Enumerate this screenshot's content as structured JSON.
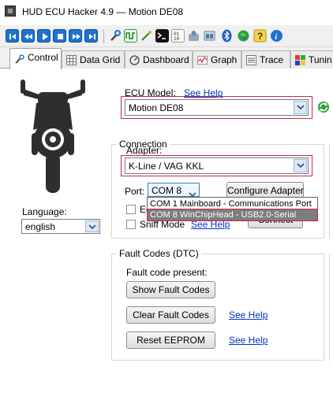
{
  "window": {
    "title": "HUD ECU Hacker 4.9  —  Motion DE08"
  },
  "toolbar": {
    "icons": [
      "go-first-icon",
      "rewind-icon",
      "play-icon",
      "stop-icon",
      "fast-forward-icon",
      "go-last-icon",
      "wrench-icon",
      "signal-icon",
      "wand-icon",
      "terminal-icon",
      "binary-file-icon",
      "tools-icon",
      "dashboard-window-icon",
      "bluetooth-icon",
      "globe-icon",
      "help-icon",
      "info-icon"
    ]
  },
  "tabs": [
    {
      "label": "Control",
      "icon": "wrench-icon",
      "active": true
    },
    {
      "label": "Data Grid",
      "icon": "grid-icon",
      "active": false
    },
    {
      "label": "Dashboard",
      "icon": "gauge-icon",
      "active": false
    },
    {
      "label": "Graph",
      "icon": "graph-icon",
      "active": false
    },
    {
      "label": "Trace",
      "icon": "list-icon",
      "active": false
    },
    {
      "label": "Tunin",
      "icon": "tuning-icon",
      "active": false
    }
  ],
  "language": {
    "label": "Language:",
    "value": "english"
  },
  "ecu": {
    "label": "ECU Model:",
    "help_link": "See Help",
    "value": "Motion DE08"
  },
  "connection": {
    "title": "Connection",
    "adapter_label": "Adapter:",
    "adapter_value": "K-Line / VAG KKL",
    "port_label": "Port:",
    "port_value": "COM  8",
    "configure_button": "Configure Adapter",
    "port_options": [
      {
        "label": "COM  1   Mainboard - Communications Port",
        "selected": false
      },
      {
        "label": "COM  8   WinChipHead - USB2.0-Serial",
        "selected": true
      }
    ],
    "checkbox1_label": "Ech",
    "sniff_label": "Sniff Mode",
    "sniff_help": "See Help",
    "connect_button": "Connect"
  },
  "fault_codes": {
    "title": "Fault Codes (DTC)",
    "present_label": "Fault code present:",
    "show_button": "Show Fault Codes",
    "clear_button": "Clear Fault Codes",
    "clear_help": "See Help",
    "reset_button": "Reset EEPROM",
    "reset_help": "See Help"
  },
  "colors": {
    "accent": "#1d72cf",
    "highlight_border": "#c8264b",
    "link": "#0033cc"
  }
}
